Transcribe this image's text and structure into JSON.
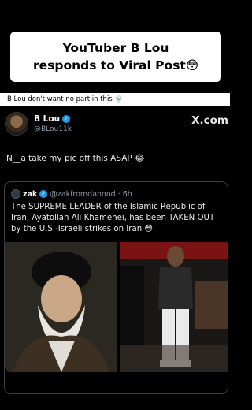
{
  "banner": {
    "line1": "YouTuber B Lou",
    "line2": "responds to Viral Post",
    "line2_emoji": "😳"
  },
  "caption": {
    "text": "B Lou don't want no part in this",
    "emoji": "💀"
  },
  "tweet": {
    "author_name": "B Lou",
    "author_handle": "@BLou11k",
    "platform_logo": "X.com",
    "text": "N__a take my pic off this ASAP",
    "text_emoji": "😂"
  },
  "quote": {
    "name": "zak",
    "handle": "@zakfromdahood",
    "time": "· 6h",
    "text": "The SUPREME LEADER of the Islamic Republic of Iran, Ayatollah Ali Khamenei, has been TAKEN OUT by the U.S.-Israeli strikes on Iran",
    "text_emoji": "😳"
  },
  "colors": {
    "verified": "#1d9bf0",
    "muted_text": "#8b98a5"
  },
  "icons": [
    "verified-badge-icon"
  ]
}
